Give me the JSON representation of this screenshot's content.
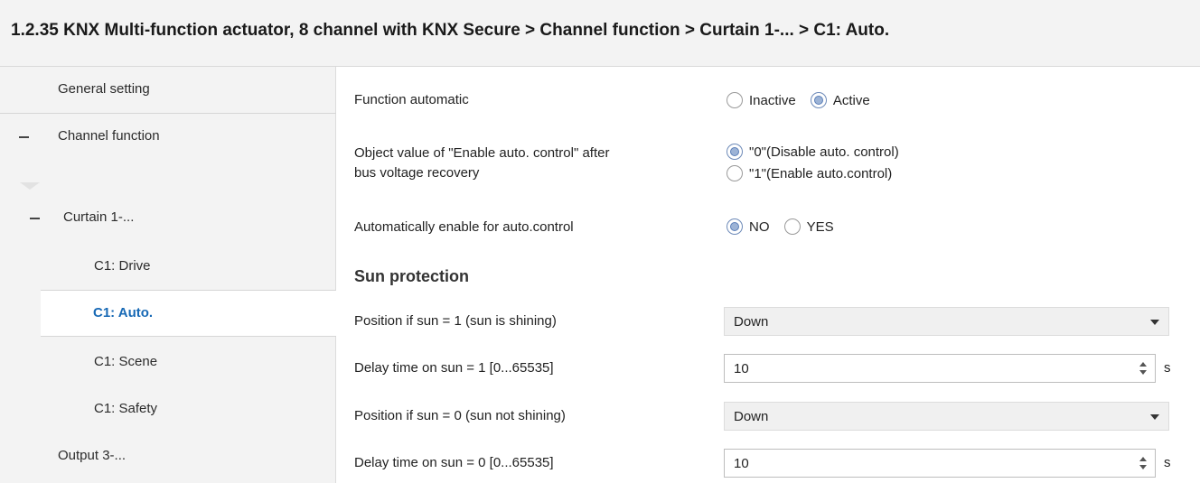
{
  "header": {
    "title": "1.2.35 KNX Multi-function actuator, 8 channel with KNX Secure > Channel function > Curtain 1-... > C1: Auto."
  },
  "sidebar": {
    "items": [
      {
        "label": "General setting"
      },
      {
        "label": "Channel function"
      },
      {
        "label": "Curtain 1-..."
      },
      {
        "label": "C1: Drive"
      },
      {
        "label": "C1: Auto."
      },
      {
        "label": "C1: Scene"
      },
      {
        "label": "C1: Safety"
      },
      {
        "label": "Output 3-..."
      }
    ]
  },
  "content": {
    "function_automatic": {
      "label": "Function automatic",
      "options": [
        "Inactive",
        "Active"
      ],
      "selected": "Active"
    },
    "enable_auto_object": {
      "label_line1": "Object value of \"Enable auto. control\" after",
      "label_line2": "bus voltage recovery",
      "options": [
        "\"0\"(Disable auto. control)",
        "\"1\"(Enable auto.control)"
      ],
      "selected": "\"0\"(Disable auto. control)"
    },
    "auto_enable": {
      "label": "Automatically enable for auto.control",
      "options": [
        "NO",
        "YES"
      ],
      "selected": "NO"
    },
    "sun_protection": {
      "title": "Sun protection",
      "pos_sun1_label": "Position if sun = 1  (sun is shining)",
      "pos_sun1_value": "Down",
      "delay_sun1_label": "Delay time on sun = 1  [0...65535]",
      "delay_sun1_value": "10",
      "pos_sun0_label": "Position if sun = 0  (sun not shining)",
      "pos_sun0_value": "Down",
      "delay_sun0_label": "Delay time on sun = 0   [0...65535]",
      "delay_sun0_value": "10",
      "unit": "s"
    }
  }
}
